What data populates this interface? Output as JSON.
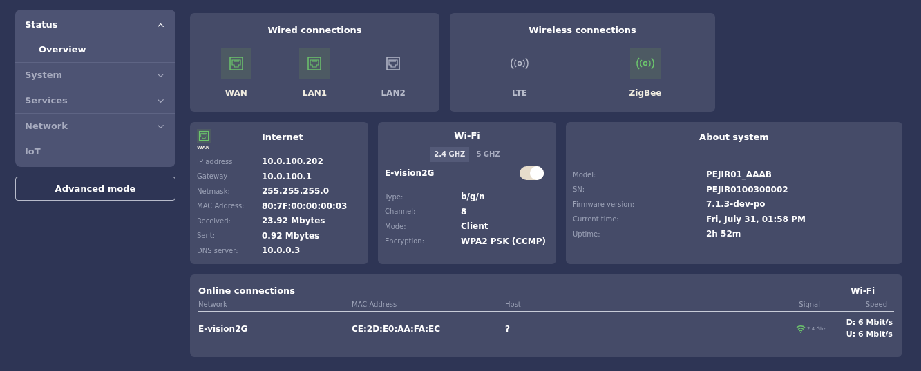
{
  "sidebar": {
    "items": [
      {
        "label": "Status",
        "expanded": true,
        "selected": true,
        "children": [
          {
            "label": "Overview",
            "selected": true
          }
        ]
      },
      {
        "label": "System",
        "expanded": false,
        "selected": false
      },
      {
        "label": "Services",
        "expanded": false,
        "selected": false
      },
      {
        "label": "Network",
        "expanded": false,
        "selected": false
      },
      {
        "label": "IoT",
        "selected": false
      }
    ],
    "button": "Advanced mode"
  },
  "wired": {
    "title": "Wired connections",
    "ports": [
      {
        "label": "WAN",
        "active": true
      },
      {
        "label": "LAN1",
        "active": true
      },
      {
        "label": "LAN2",
        "active": false
      }
    ]
  },
  "wireless": {
    "title": "Wireless connections",
    "ports": [
      {
        "label": "LTE",
        "active": false
      },
      {
        "label": "ZigBee",
        "active": true
      }
    ]
  },
  "internet": {
    "title": "Internet",
    "port": {
      "label": "WAN",
      "active": true
    },
    "rows": [
      {
        "label": "IP address",
        "value": "10.0.100.202"
      },
      {
        "label": "Gateway",
        "value": "10.0.100.1"
      },
      {
        "label": "Netmask:",
        "value": "255.255.255.0"
      },
      {
        "label": "MAC Address:",
        "value": "80:7F:00:00:00:03"
      },
      {
        "label": "Received:",
        "value": "23.92 Mbytes"
      },
      {
        "label": "Sent:",
        "value": "0.92 Mbytes"
      },
      {
        "label": "DNS server:",
        "value": "10.0.0.3"
      }
    ]
  },
  "wifi": {
    "title": "Wi-Fi",
    "bands": [
      {
        "label": "2.4 GHZ",
        "selected": true
      },
      {
        "label": "5 GHZ",
        "selected": false
      }
    ],
    "ssid": "E-vision2G",
    "on": true,
    "rows": [
      {
        "label": "Type:",
        "value": "b/g/n"
      },
      {
        "label": "Channel:",
        "value": "8"
      },
      {
        "label": "Mode:",
        "value": "Client"
      },
      {
        "label": "Encryption:",
        "value": "WPA2 PSK (CCMP)"
      }
    ]
  },
  "about": {
    "title": "About system",
    "rows": [
      {
        "label": "Model:",
        "value": "PEJIR01_AAAB"
      },
      {
        "label": "SN:",
        "value": "PEJIR0100300002"
      },
      {
        "label": "Firmware version:",
        "value": "7.1.3-dev-po"
      },
      {
        "label": "Current time:",
        "value": "Fri, July 31, 01:58 PM"
      },
      {
        "label": "Uptime:",
        "value": "2h 52m"
      }
    ]
  },
  "online": {
    "title": "Online connections",
    "group": "Wi-Fi",
    "columns": [
      "Network",
      "MAC Address",
      "Host",
      "Signal",
      "Speed"
    ],
    "rows": [
      {
        "network": "E-vision2G",
        "mac": "CE:2D:E0:AA:FA:EC",
        "host": "?",
        "band": "2.4 Ghz",
        "down": "D: 6 Mbit/s",
        "up": "U: 6 Mbit/s"
      }
    ]
  }
}
